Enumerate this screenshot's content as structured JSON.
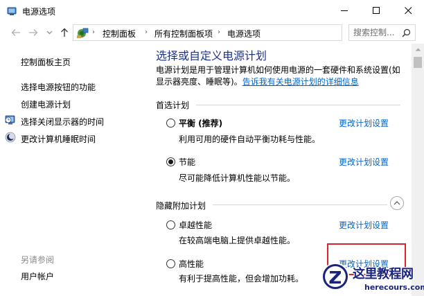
{
  "window": {
    "title": "电源选项"
  },
  "nav": {
    "breadcrumb": [
      "控制面板",
      "所有控制面板项",
      "电源选项"
    ],
    "search_placeholder": "搜索控制..."
  },
  "left_pane": {
    "links": [
      "控制面板主页",
      "选择电源按钮的功能",
      "创建电源计划",
      "选择关闭显示器的时间",
      "更改计算机睡眠时间"
    ],
    "see_also_label": "另请参阅",
    "see_also_links": [
      "用户帐户"
    ]
  },
  "main": {
    "heading": "选择或自定义电源计划",
    "description": "电源计划是用于管理计算机如何使用电源的一套硬件和系统设置(如显示器亮度、睡眠等)。",
    "description_link": "告诉我有关电源计划的详细信息",
    "preferred_section": "首选计划",
    "hidden_section": "隐藏附加计划",
    "plans": [
      {
        "name": "平衡 (推荐)",
        "description": "利用可用的硬件自动平衡功耗与性能。",
        "link": "更改计划设置",
        "selected": false,
        "bold": true
      },
      {
        "name": "节能",
        "description": "尽可能降低计算机性能以节能。",
        "link": "更改计划设置",
        "selected": true,
        "bold": false
      },
      {
        "name": "卓越性能",
        "description": "在较高端电脑上提供卓越性能。",
        "link": "更改计划设置",
        "selected": false,
        "bold": false
      },
      {
        "name": "高性能",
        "description": "有利于提高性能，但会增加功耗。",
        "link": "更改计划设置",
        "selected": false,
        "bold": false
      }
    ]
  },
  "watermark": {
    "title": "这里教程网",
    "url": "herecours.com"
  },
  "colors": {
    "heading": "#1e3287",
    "link": "#0066cc",
    "highlight": "#d9232e"
  }
}
